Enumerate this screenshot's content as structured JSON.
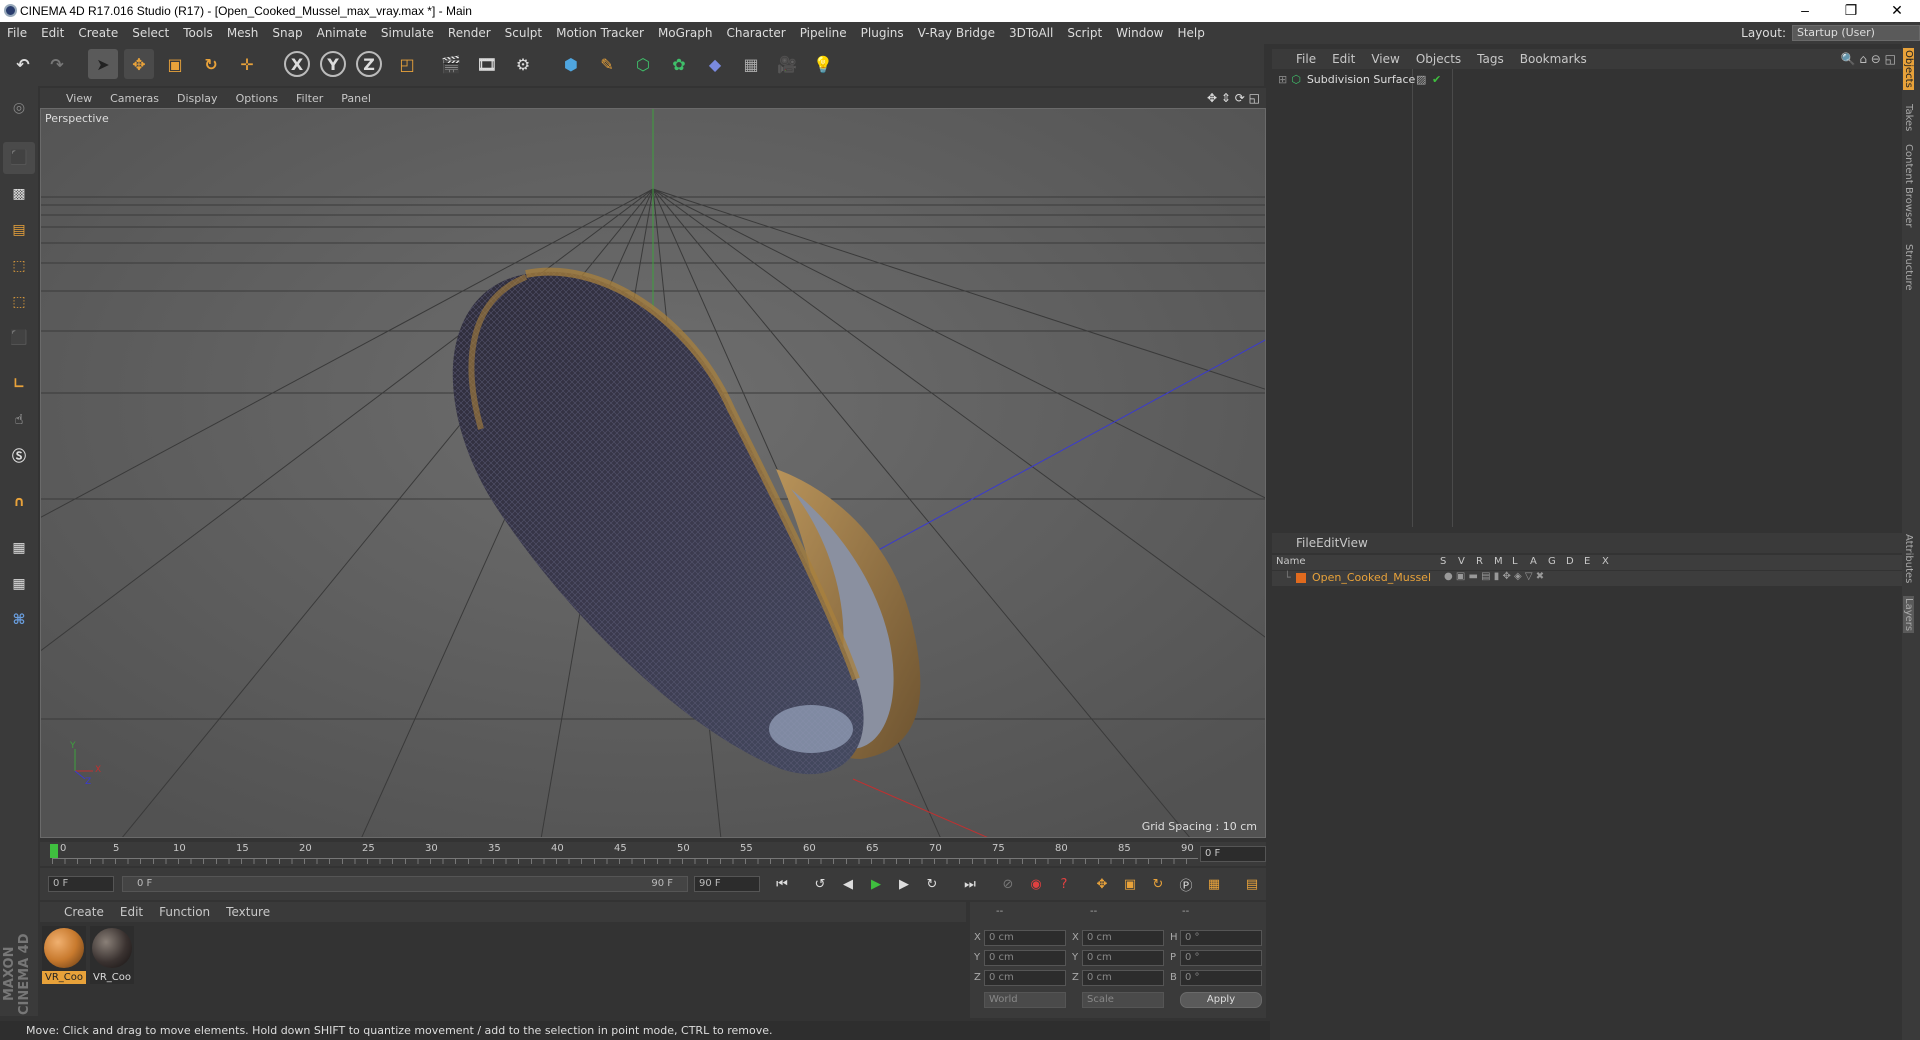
{
  "window": {
    "title": "CINEMA 4D R17.016 Studio (R17) - [Open_Cooked_Mussel_max_vray.max *] - Main",
    "controls": [
      "–",
      "❐",
      "✕"
    ]
  },
  "menubar": {
    "items": [
      "File",
      "Edit",
      "Create",
      "Select",
      "Tools",
      "Mesh",
      "Snap",
      "Animate",
      "Simulate",
      "Render",
      "Sculpt",
      "Motion Tracker",
      "MoGraph",
      "Character",
      "Pipeline",
      "Plugins",
      "V-Ray Bridge",
      "3DToAll",
      "Script",
      "Window",
      "Help"
    ],
    "layout_label": "Layout:",
    "layout_value": "Startup (User)"
  },
  "toolbar": {
    "icons": [
      "undo-icon",
      "redo-icon",
      "select-arrow-icon",
      "move-icon",
      "scale-icon",
      "rotate-icon",
      "move-plus-icon",
      "x-axis-icon",
      "y-axis-icon",
      "z-axis-icon",
      "coordinate-system-icon",
      "render-view-icon",
      "render-picture-viewer-icon",
      "render-settings-icon",
      "cube-icon",
      "pen-icon",
      "subdivision-icon",
      "array-icon",
      "deformer-icon",
      "floor-icon",
      "camera-icon",
      "light-icon"
    ],
    "axis_labels": [
      "X",
      "Y",
      "Z"
    ]
  },
  "lefttoolbar": {
    "icons": [
      "make-editable-icon",
      "model-mode-icon",
      "texture-mode-icon",
      "workplane-icon",
      "points-mode-icon",
      "edges-mode-icon",
      "polygons-mode-icon",
      "axis-mode-icon",
      "tweak-icon",
      "solo-icon",
      "magnet-icon",
      "snap-icon",
      "lock-workplane-icon",
      "python-icon"
    ]
  },
  "viewport": {
    "menu": [
      "View",
      "Cameras",
      "Display",
      "Options",
      "Filter",
      "Panel"
    ],
    "label": "Perspective",
    "grid_spacing": "Grid Spacing : 10 cm",
    "axis_labels": [
      "Y",
      "X",
      "Z"
    ]
  },
  "timeline": {
    "ticks": [
      "0",
      "5",
      "10",
      "15",
      "20",
      "25",
      "30",
      "35",
      "40",
      "45",
      "50",
      "55",
      "60",
      "65",
      "70",
      "75",
      "80",
      "85",
      "90"
    ],
    "current_frame": "0 F",
    "start_field": "0 F",
    "range_start": "0 F",
    "range_end": "90 F",
    "end_field": "90 F"
  },
  "materials": {
    "menu": [
      "Create",
      "Edit",
      "Function",
      "Texture"
    ],
    "items": [
      {
        "label": "VR_Coo",
        "color": "#c87a2e"
      },
      {
        "label": "VR_Coo",
        "color": "#3a3230"
      }
    ]
  },
  "coordinates": {
    "headers": [
      "--",
      "--",
      "--"
    ],
    "rows": [
      {
        "a": "X",
        "av": "0 cm",
        "b": "X",
        "bv": "0 cm",
        "c": "H",
        "cv": "0 °"
      },
      {
        "a": "Y",
        "av": "0 cm",
        "b": "Y",
        "bv": "0 cm",
        "c": "P",
        "cv": "0 °"
      },
      {
        "a": "Z",
        "av": "0 cm",
        "b": "Z",
        "bv": "0 cm",
        "c": "B",
        "cv": "0 °"
      }
    ],
    "world": "World",
    "scale": "Scale",
    "apply": "Apply"
  },
  "objects": {
    "menu": [
      "File",
      "Edit",
      "View",
      "Objects",
      "Tags",
      "Bookmarks"
    ],
    "items": [
      {
        "name": "Subdivision Surface"
      }
    ]
  },
  "layers": {
    "menu": [
      "File",
      "Edit",
      "View"
    ],
    "header": {
      "name": "Name",
      "cols": [
        "S",
        "V",
        "R",
        "M",
        "L",
        "A",
        "G",
        "D",
        "E",
        "X"
      ]
    },
    "items": [
      {
        "name": "Open_Cooked_Mussel",
        "color": "#e06a1e"
      }
    ]
  },
  "side_tabs": [
    "Objects",
    "Takes",
    "Content Browser",
    "Structure",
    "Attributes",
    "Layers"
  ],
  "status": "Move: Click and drag to move elements. Hold down SHIFT to quantize movement / add to the selection in point mode, CTRL to remove.",
  "maxon_brand": "MAXON CINEMA 4D",
  "colors": {
    "accent": "#e8a23a",
    "selection": "#e06a1e"
  }
}
